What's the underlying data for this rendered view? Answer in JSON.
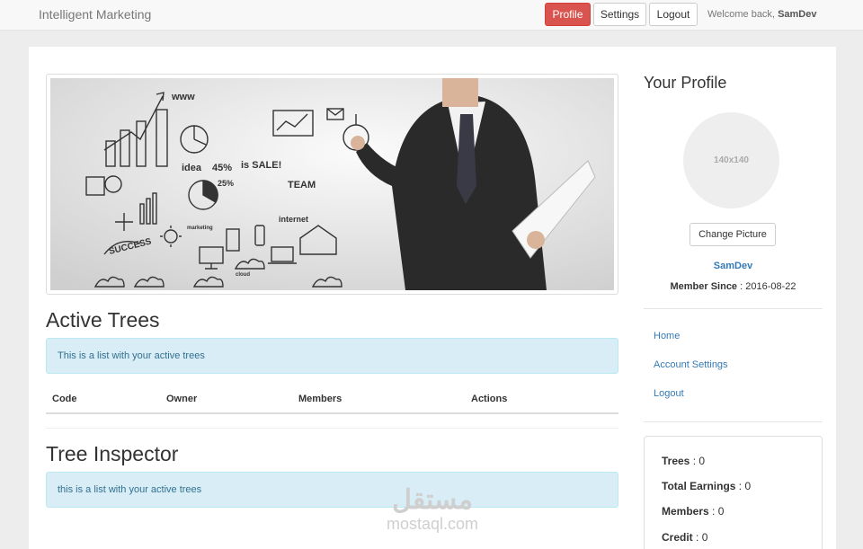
{
  "navbar": {
    "brand": "Intelligent Marketing",
    "buttons": {
      "profile": "Profile",
      "settings": "Settings",
      "logout": "Logout"
    },
    "welcome_prefix": "Welcome back,",
    "username": "SamDev"
  },
  "hero": {
    "scribbles": [
      "www",
      "idea",
      "45%",
      "is SALE!",
      "TEAM",
      "internet",
      "SUCCESS",
      "25%",
      "marketing",
      "cloud"
    ]
  },
  "active_trees": {
    "title": "Active Trees",
    "alert": "This is a list with your active trees",
    "columns": [
      "Code",
      "Owner",
      "Members",
      "Actions"
    ]
  },
  "tree_inspector": {
    "title": "Tree Inspector",
    "alert": "this is a list with your active trees"
  },
  "profile": {
    "title": "Your Profile",
    "avatar_placeholder": "140x140",
    "change_picture": "Change Picture",
    "username": "SamDev",
    "member_since_label": "Member Since",
    "member_since_value": "2016-08-22"
  },
  "links": [
    "Home",
    "Account Settings",
    "Logout"
  ],
  "stats": [
    {
      "label": "Trees",
      "value": "0"
    },
    {
      "label": "Total Earnings",
      "value": "0"
    },
    {
      "label": "Members",
      "value": "0"
    },
    {
      "label": "Credit",
      "value": "0"
    }
  ],
  "watermark": {
    "arabic": "مستقل",
    "latin": "mostaql.com"
  },
  "colors": {
    "danger": "#d9534f",
    "link": "#337ab7",
    "info_bg": "#d9edf7",
    "info_text": "#31708f"
  }
}
